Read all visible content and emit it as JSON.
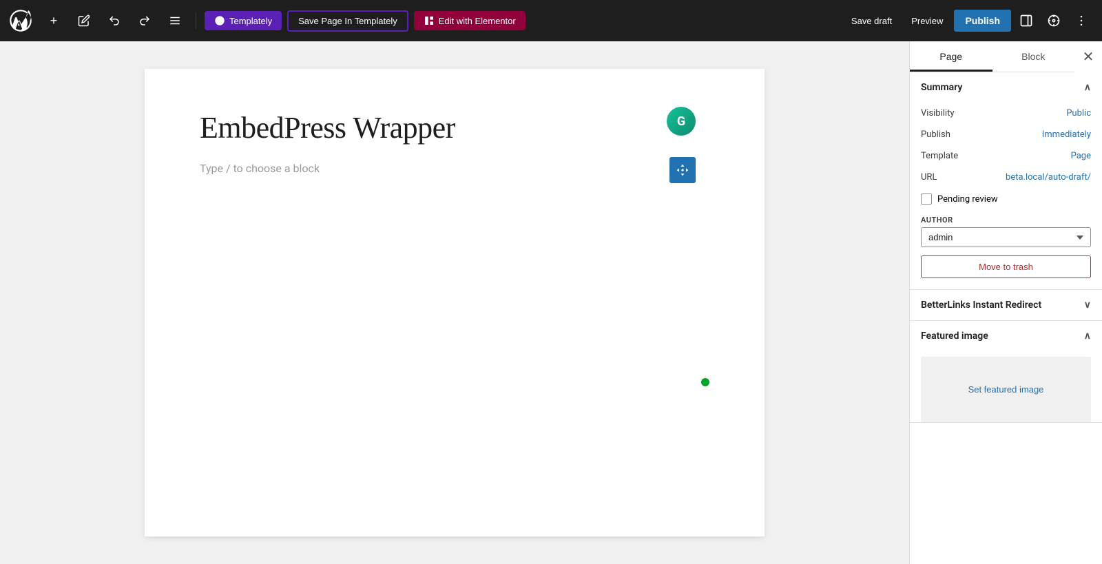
{
  "toolbar": {
    "wp_logo_title": "WordPress",
    "add_label": "+",
    "edit_label": "✏",
    "undo_label": "↩",
    "redo_label": "↪",
    "tools_label": "≡",
    "templately_label": "Templately",
    "save_templately_label": "Save Page In Templately",
    "elementor_label": "Edit with Elementor",
    "save_draft_label": "Save draft",
    "preview_label": "Preview",
    "publish_label": "Publish",
    "toggle_sidebar_label": "☰",
    "settings_label": "⚙",
    "more_label": "⋮"
  },
  "editor": {
    "page_title": "EmbedPress Wrapper",
    "block_placeholder": "Type / to choose a block"
  },
  "sidebar": {
    "tab_page": "Page",
    "tab_block": "Block",
    "close_label": "✕",
    "summary_label": "Summary",
    "visibility_label": "Visibility",
    "visibility_value": "Public",
    "publish_label": "Publish",
    "publish_value": "Immediately",
    "template_label": "Template",
    "template_value": "Page",
    "url_label": "URL",
    "url_value": "beta.local/auto-draft/",
    "pending_review_label": "Pending review",
    "author_label": "AUTHOR",
    "author_options": [
      "admin"
    ],
    "author_selected": "admin",
    "move_to_trash_label": "Move to trash",
    "betterlinks_label": "BetterLinks Instant Redirect",
    "featured_image_label": "Featured image",
    "set_featured_image_label": "Set featured image"
  }
}
